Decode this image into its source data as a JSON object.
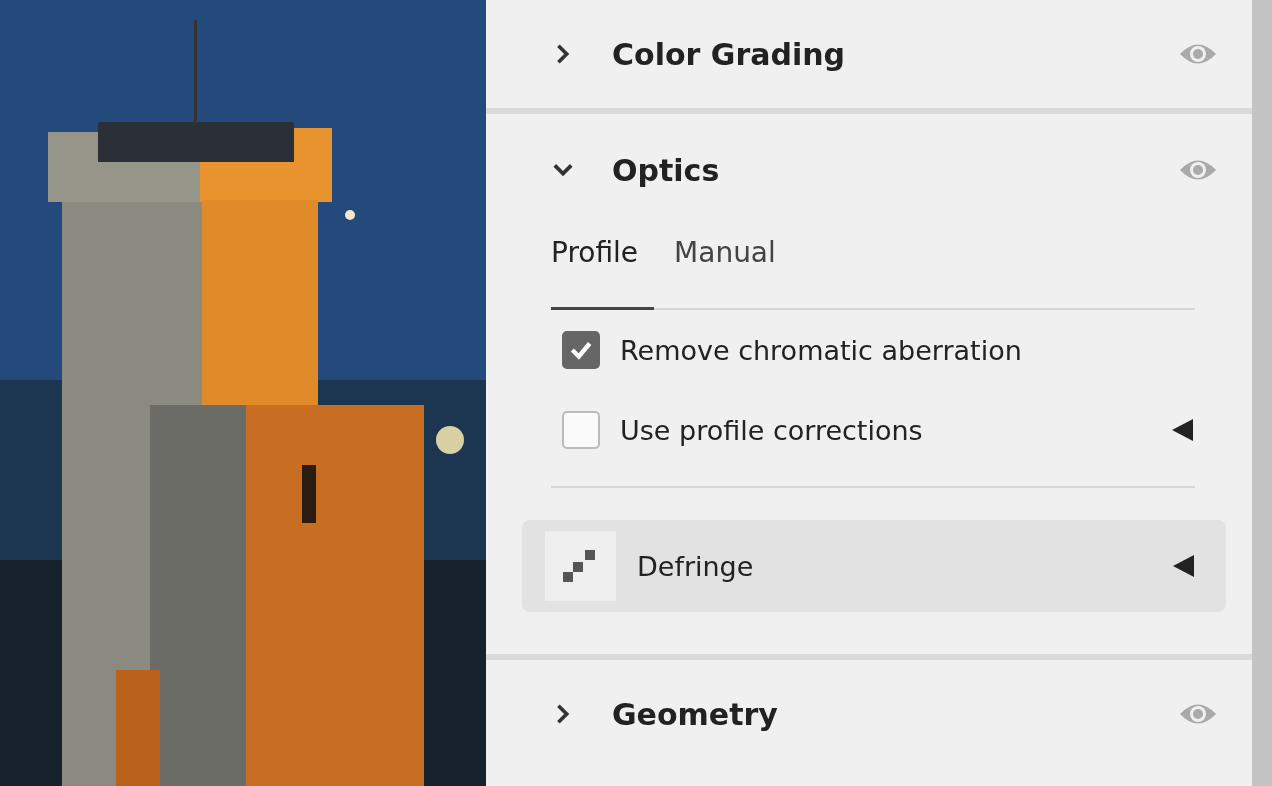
{
  "sections": [
    {
      "title": "Color Grading",
      "expanded": false
    },
    {
      "title": "Optics",
      "expanded": true,
      "tabs": [
        {
          "label": "Profile",
          "selected": true
        },
        {
          "label": "Manual",
          "selected": false
        }
      ],
      "options": [
        {
          "label": "Remove chromatic aberration",
          "checked": true,
          "submenu": false
        },
        {
          "label": "Use profile corrections",
          "checked": false,
          "submenu": true
        }
      ],
      "tool": {
        "label": "Defringe",
        "submenu": true
      }
    },
    {
      "title": "Geometry",
      "expanded": false
    }
  ]
}
